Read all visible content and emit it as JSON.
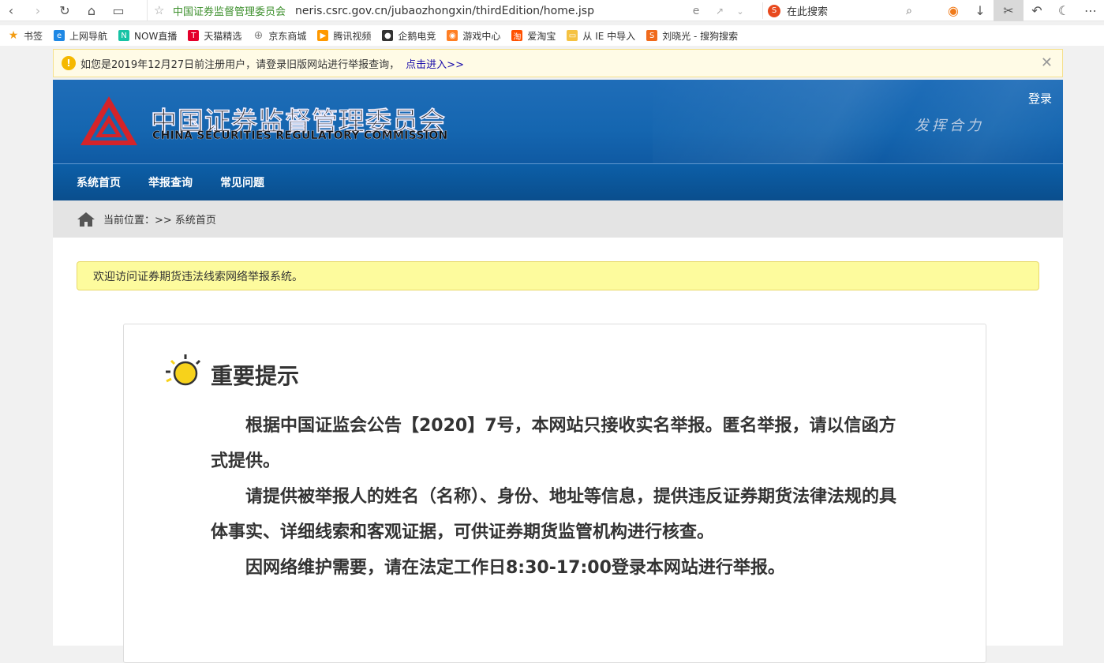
{
  "browser": {
    "site_name": "中国证券监督管理委员会",
    "url": "neris.csrc.gov.cn/jubaozhongxin/thirdEdition/home.jsp",
    "search_placeholder": "在此搜索"
  },
  "bookmarks": [
    {
      "label": "书签",
      "icon": "star-icon",
      "color": "#f39c12"
    },
    {
      "label": "上网导航",
      "icon": "ie-icon",
      "color": "#1e88e5"
    },
    {
      "label": "NOW直播",
      "icon": "now-icon",
      "color": "#17c3a5"
    },
    {
      "label": "天猫精选",
      "icon": "tmall-icon",
      "color": "#e4002b"
    },
    {
      "label": "京东商城",
      "icon": "globe-icon",
      "color": "#888888"
    },
    {
      "label": "腾讯视频",
      "icon": "play-icon",
      "color": "#ff9900"
    },
    {
      "label": "企鹅电竞",
      "icon": "penguin-icon",
      "color": "#333333"
    },
    {
      "label": "游戏中心",
      "icon": "gamepad-icon",
      "color": "#ff7f24"
    },
    {
      "label": "爱淘宝",
      "icon": "taobao-icon",
      "color": "#ff5000"
    },
    {
      "label": "从 IE 中导入",
      "icon": "folder-icon",
      "color": "#f5c242"
    },
    {
      "label": "刘晓光 - 搜狗搜索",
      "icon": "sogou-icon",
      "color": "#f06a1c"
    }
  ],
  "notice": {
    "text": "如您是2019年12月27日前注册用户，请登录旧版网站进行举报查询，",
    "link": "点击进入>>"
  },
  "header": {
    "title_cn": "中国证券监督管理委员会",
    "title_en": "CHINA SECURITIES REGULATORY COMMISSION",
    "login": "登录",
    "slogan": "发挥合力"
  },
  "nav": [
    "系统首页",
    "举报查询",
    "常见问题"
  ],
  "breadcrumb": {
    "label": "当前位置：>> 系统首页"
  },
  "welcome": "欢迎访问证券期货违法线索网络举报系统。",
  "tips": {
    "title": "重要提示",
    "paragraphs": [
      "根据中国证监会公告【2020】7号，本网站只接收实名举报。匿名举报，请以信函方式提供。",
      "请提供被举报人的姓名（名称）、身份、地址等信息，提供违反证券期货法律法规的具体事实、详细线索和客观证据，可供证券期货监管机构进行核查。",
      "因网络维护需要，请在法定工作日8:30-17:00登录本网站进行举报。"
    ]
  },
  "colors": {
    "header_blue": "#1566b0",
    "nav_blue": "#0a4e8d",
    "welcome_yellow": "#fdfb9d",
    "logo_red": "#d4242a"
  }
}
